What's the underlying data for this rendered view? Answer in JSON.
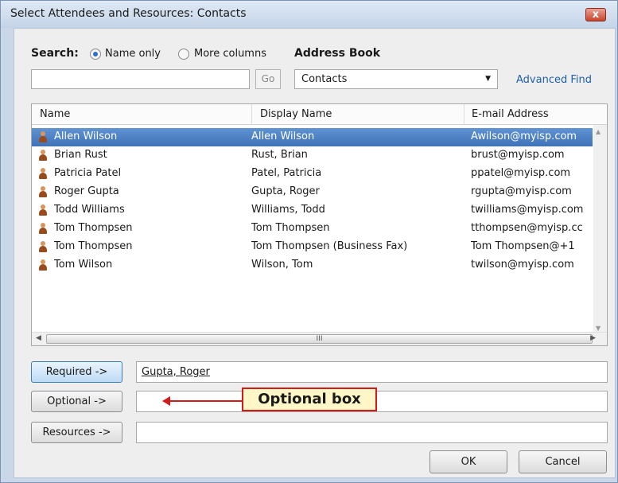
{
  "window": {
    "title": "Select Attendees and Resources: Contacts",
    "close_label": "x"
  },
  "search": {
    "label": "Search:",
    "option_name_only": "Name only",
    "option_more_columns": "More columns",
    "selected": "Name only",
    "value": "",
    "go_label": "Go"
  },
  "address_book": {
    "label": "Address Book",
    "selected": "Contacts",
    "advanced_find": "Advanced Find"
  },
  "list": {
    "columns": [
      "Name",
      "Display Name",
      "E-mail Address"
    ],
    "rows": [
      {
        "name": "Allen Wilson",
        "display": "Allen Wilson",
        "email": "Awilson@myisp.com"
      },
      {
        "name": "Brian Rust",
        "display": "Rust, Brian",
        "email": "brust@myisp.com"
      },
      {
        "name": "Patricia Patel",
        "display": "Patel, Patricia",
        "email": "ppatel@myisp.com"
      },
      {
        "name": "Roger Gupta",
        "display": "Gupta, Roger",
        "email": "rgupta@myisp.com"
      },
      {
        "name": "Todd Williams",
        "display": "Williams, Todd",
        "email": "twilliams@myisp.com"
      },
      {
        "name": "Tom Thompsen",
        "display": "Tom Thompsen",
        "email": "tthompsen@myisp.cc"
      },
      {
        "name": "Tom Thompsen",
        "display": "Tom Thompsen (Business Fax)",
        "email": "Tom Thompsen@+1"
      },
      {
        "name": "Tom Wilson",
        "display": "Wilson, Tom",
        "email": "twilson@myisp.com"
      }
    ],
    "selected_row": "Allen Wilson",
    "hscroll_grip": "III"
  },
  "recipients": {
    "required_label": "Required ->",
    "required_value": "Gupta, Roger",
    "optional_label": "Optional ->",
    "optional_value": "",
    "resources_label": "Resources ->",
    "resources_value": ""
  },
  "annotation": {
    "callout": "Optional box",
    "color": "#d21c1c"
  },
  "footer": {
    "ok_label": "OK",
    "cancel_label": "Cancel"
  }
}
